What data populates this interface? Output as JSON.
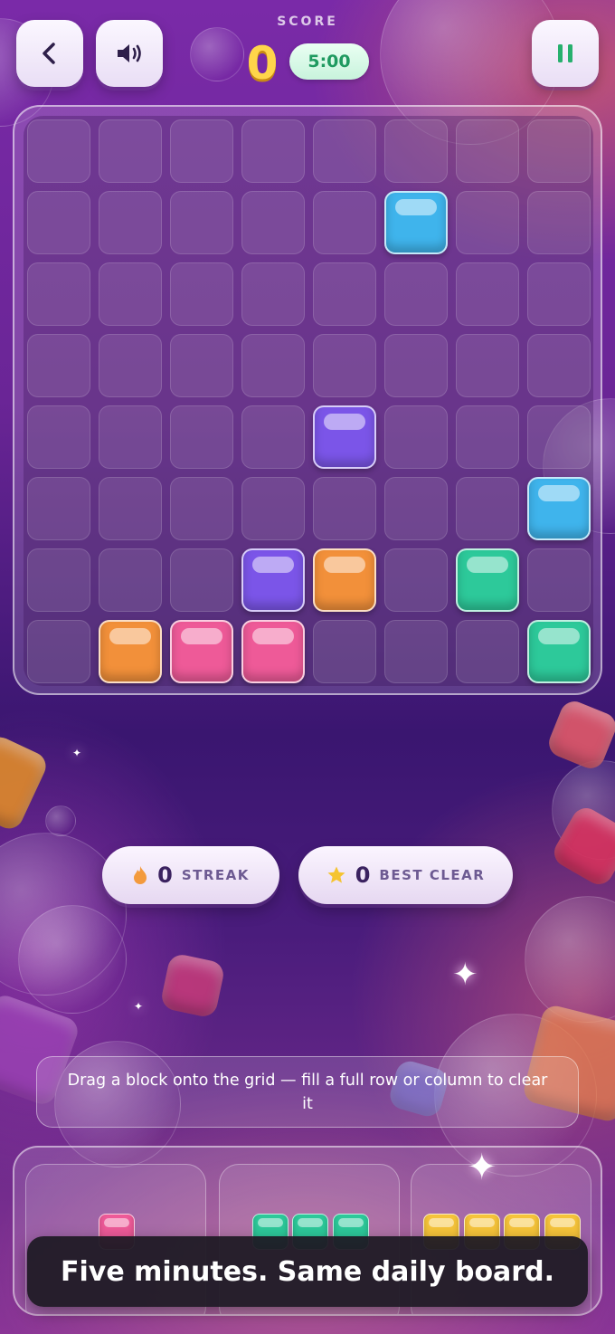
{
  "header": {
    "back_icon": "chevron-left-icon",
    "sound_icon": "speaker-icon",
    "pause_icon": "pause-icon",
    "score_label": "SCORE",
    "score_value": "0",
    "timer": "5:00"
  },
  "board": {
    "rows": 8,
    "cols": 8,
    "blocks": [
      {
        "row": 1,
        "col": 5,
        "color": "blue"
      },
      {
        "row": 4,
        "col": 4,
        "color": "purple"
      },
      {
        "row": 5,
        "col": 7,
        "color": "blue"
      },
      {
        "row": 6,
        "col": 3,
        "color": "purple"
      },
      {
        "row": 6,
        "col": 4,
        "color": "orange"
      },
      {
        "row": 6,
        "col": 6,
        "color": "green"
      },
      {
        "row": 7,
        "col": 1,
        "color": "orange"
      },
      {
        "row": 7,
        "col": 2,
        "color": "pink"
      },
      {
        "row": 7,
        "col": 3,
        "color": "pink"
      },
      {
        "row": 7,
        "col": 7,
        "color": "green"
      }
    ]
  },
  "colors": {
    "blue": "#3fb4ec",
    "purple": "#7b55e8",
    "orange": "#f2903a",
    "pink": "#ee5a98",
    "green": "#2dc99a",
    "yellow": "#f6c43a"
  },
  "stats": {
    "streak": {
      "icon": "flame-icon",
      "value": "0",
      "label": "STREAK"
    },
    "best": {
      "icon": "star-icon",
      "value": "0",
      "label": "BEST CLEAR"
    }
  },
  "hint": "Drag a block onto the grid — fill a full row or column to clear it",
  "tray": {
    "pieces": [
      {
        "color": "pink",
        "length": 1
      },
      {
        "color": "green",
        "length": 3
      },
      {
        "color": "yellow",
        "length": 4
      }
    ]
  },
  "toast": "Five minutes. Same daily board."
}
